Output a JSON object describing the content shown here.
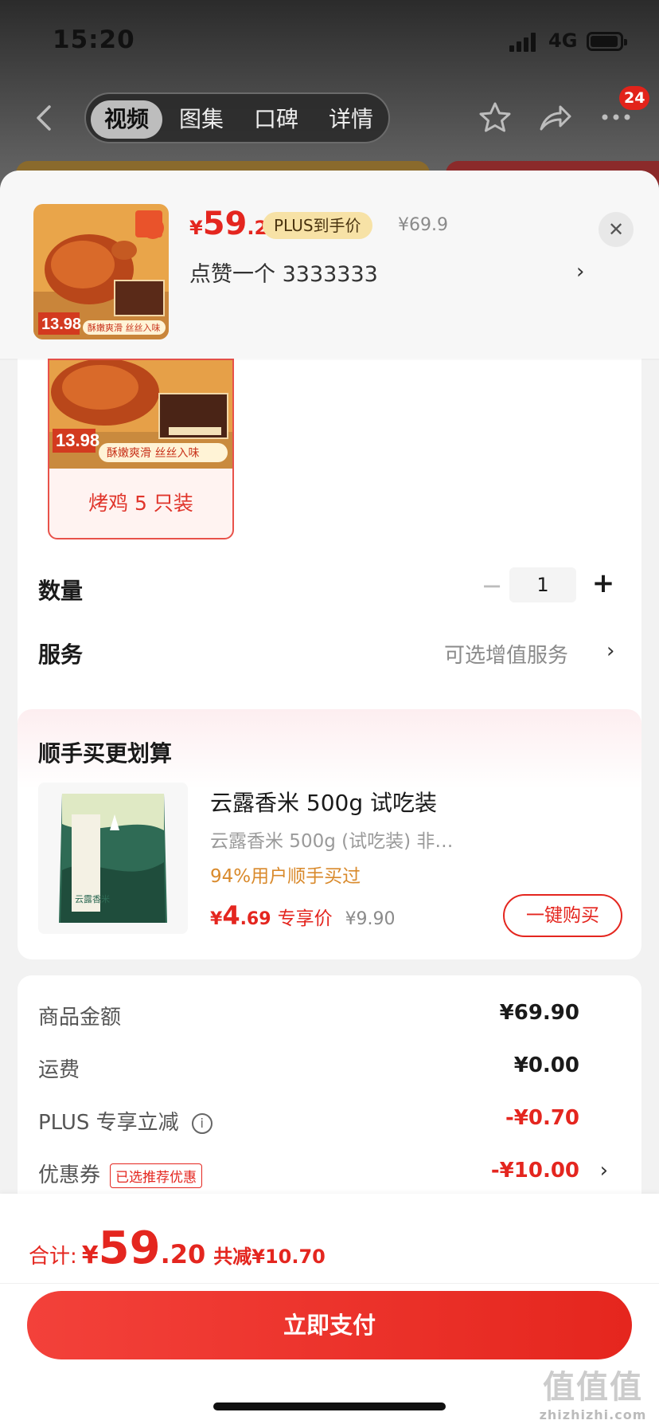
{
  "status": {
    "time": "15:20",
    "network": "4G"
  },
  "nav": {
    "tabs": [
      {
        "label": "视频",
        "active": true
      },
      {
        "label": "图集",
        "active": false
      },
      {
        "label": "口碑",
        "active": false
      },
      {
        "label": "详情",
        "active": false
      }
    ],
    "badge_count": "24"
  },
  "header": {
    "price_currency": "¥",
    "price_int": "59",
    "price_dec": ".2",
    "plus_tag": "PLUS到手价",
    "original_price": "¥69.9",
    "spec_text": "点赞一个  3333333",
    "thumb_badge_price": "13.98",
    "thumb_tagline": "酥嫩爽滑 丝丝入味"
  },
  "variant": {
    "label": "烤鸡 5 只装",
    "img_price": "13.98",
    "img_tagline": "酥嫩爽滑 丝丝入味"
  },
  "quantity": {
    "label": "数量",
    "value": "1"
  },
  "service": {
    "label": "服务",
    "value": "可选增值服务"
  },
  "combo": {
    "title": "顺手买更划算",
    "product_name": "云露香米 500g 试吃装",
    "product_desc": "云露香米 500g (试吃装) 非…",
    "bought_text": "94%用户顺手买过",
    "price_currency": "¥",
    "price_int": "4",
    "price_dec": ".69",
    "exclusive_label": "专享价",
    "original_price": "¥9.90",
    "buy_button": "一键购买",
    "package_text": "云露香米"
  },
  "summary": {
    "rows": [
      {
        "label": "商品金额",
        "value": "¥69.90"
      },
      {
        "label": "运费",
        "value": "¥0.00"
      },
      {
        "label": "PLUS 专享立减",
        "value": "-¥0.70"
      },
      {
        "label": "优惠券",
        "value": "-¥10.00",
        "tag": "已选推荐优惠"
      }
    ]
  },
  "footer": {
    "total_label": "合计:",
    "total_currency": "¥",
    "total_int": "59",
    "total_dec": ".20",
    "total_saving": "共减¥10.70",
    "pay_button": "立即支付"
  },
  "watermark": {
    "text": "值值值",
    "sub": "zhizhizhi.com"
  },
  "colors": {
    "accent": "#e4261f",
    "plus_tag_bg": "#f7e2a6",
    "background": "#f2f2f2"
  }
}
